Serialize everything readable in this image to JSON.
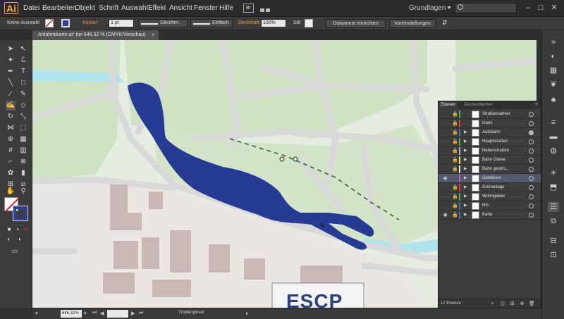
{
  "app": {
    "logo": "Ai",
    "menus": [
      "Datei",
      "Bearbeiten",
      "Objekt",
      "Schrift",
      "Auswahl",
      "Effekt",
      "Ansicht",
      "Fenster",
      "Hilfe"
    ],
    "bridge_label": "Br",
    "workspace": "Grundlagen",
    "window_controls": [
      "–",
      "□",
      "✕"
    ]
  },
  "control_bar": {
    "selection": "Keine Auswahl",
    "stroke_label": "Kontur:",
    "stroke_weight": "1 pt",
    "profile": "Gleichm.",
    "brush": "Einfach",
    "opacity_label": "Deckkraft:",
    "opacity": "100%",
    "style_label": "Stil:",
    "doc_setup_button": "Dokument einrichten",
    "preferences_button": "Voreinstellungen"
  },
  "document": {
    "tab_title": "Anfahrtskarte.ai* bei 646,32 % (CMYK/Vorschau)",
    "close": "×"
  },
  "map": {
    "signage_text": "ESCP",
    "water_color": "#263b94",
    "park_color": "#cfe3c2",
    "street_color": "#dcdcdc",
    "building_color": "#c9b8b6"
  },
  "layers_panel": {
    "tabs": [
      "Ebenen",
      "Zeichenflächen"
    ],
    "layers": [
      {
        "name": "Straßennamen",
        "color": "#4caf50",
        "visible": false,
        "locked": true,
        "has_children": false,
        "selected": false,
        "target_filled": false
      },
      {
        "name": "Icons",
        "color": "#e53935",
        "visible": false,
        "locked": true,
        "has_children": false,
        "selected": false,
        "target_filled": false
      },
      {
        "name": "Autobahn",
        "color": "#3d6cc4",
        "visible": false,
        "locked": true,
        "has_children": true,
        "selected": false,
        "target_filled": true
      },
      {
        "name": "Hauptstraßen",
        "color": "#4caf50",
        "visible": false,
        "locked": true,
        "has_children": true,
        "selected": false,
        "target_filled": false
      },
      {
        "name": "Nebenstraßen",
        "color": "#c0aad0",
        "visible": false,
        "locked": true,
        "has_children": true,
        "selected": false,
        "target_filled": false
      },
      {
        "name": "Bahn Gleise",
        "color": "#f2e257",
        "visible": false,
        "locked": true,
        "has_children": true,
        "selected": false,
        "target_filled": false
      },
      {
        "name": "Bahn gestric...",
        "color": "#e8e8e8",
        "visible": false,
        "locked": true,
        "has_children": true,
        "selected": false,
        "target_filled": false
      },
      {
        "name": "Gewässer",
        "color": "#c458c4",
        "visible": true,
        "locked": false,
        "has_children": true,
        "selected": true,
        "target_filled": false
      },
      {
        "name": "Grünanlage",
        "color": "#e53935",
        "visible": false,
        "locked": true,
        "has_children": true,
        "selected": false,
        "target_filled": false
      },
      {
        "name": "Wohngebiet",
        "color": "#4caf50",
        "visible": false,
        "locked": true,
        "has_children": true,
        "selected": false,
        "target_filled": false
      },
      {
        "name": "HG",
        "color": "#3d6cc4",
        "visible": false,
        "locked": true,
        "has_children": true,
        "selected": false,
        "target_filled": false
      },
      {
        "name": "Karte",
        "color": "#3d6cc4",
        "visible": true,
        "locked": true,
        "has_children": true,
        "selected": false,
        "target_filled": false
      }
    ],
    "footer_count": "12 Ebenen"
  },
  "status_bar": {
    "zoom": "646,32%",
    "tool_name": "Tropfenpinsel"
  }
}
